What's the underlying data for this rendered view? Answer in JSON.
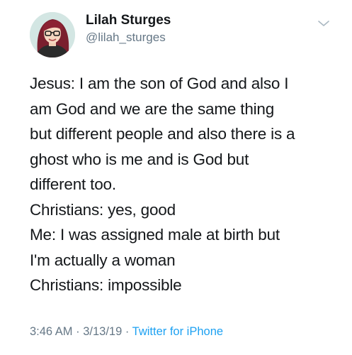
{
  "author": {
    "display_name": "Lilah Sturges",
    "handle": "@lilah_sturges",
    "avatar_icon": "profile-avatar-icon"
  },
  "menu_icon": "chevron-down-icon",
  "tweet": {
    "lines": [
      "Jesus: I am the son of God and also I",
      "am God and we are the same thing",
      "but different people and also there is a",
      "ghost who is me and is God but",
      "different too.",
      "Christians: yes, good",
      "Me: I was assigned male at birth but",
      "I'm actually a woman",
      "Christians: impossible"
    ]
  },
  "meta": {
    "time": "3:46 AM",
    "separator": " · ",
    "date": "3/13/19",
    "source": "Twitter for iPhone"
  },
  "colors": {
    "text": "#14171a",
    "secondary": "#657786",
    "link": "#1da1f2",
    "background": "#ffffff"
  }
}
